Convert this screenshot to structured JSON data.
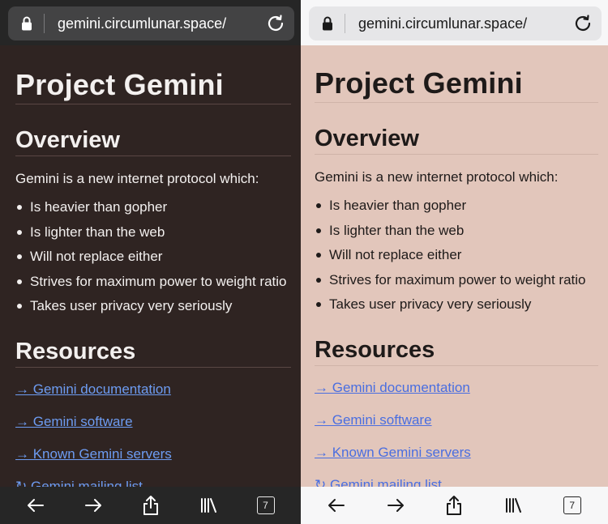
{
  "browser": {
    "url": "gemini.circumlunar.space/",
    "tab_count": "7"
  },
  "page": {
    "title": "Project Gemini",
    "overview_heading": "Overview",
    "intro": "Gemini is a new internet protocol which:",
    "bullets": [
      "Is heavier than gopher",
      "Is lighter than the web",
      "Will not replace either",
      "Strives for maximum power to weight ratio",
      "Takes user privacy very seriously"
    ],
    "resources_heading": "Resources",
    "links": [
      "→ Gemini documentation",
      "→ Gemini software",
      "→ Known Gemini servers",
      "↻ Gemini mailing list"
    ]
  },
  "themes": {
    "dark_background": "#2f2422",
    "light_background": "#e2c6bb",
    "dark_link": "#6d9cf2",
    "light_link": "#4a6ee0"
  },
  "icons": {
    "url_bar": [
      "lock-icon",
      "reload-icon"
    ],
    "toolbar": [
      "back-arrow-icon",
      "forward-arrow-icon",
      "share-icon",
      "library-icon",
      "tabs-icon"
    ]
  }
}
